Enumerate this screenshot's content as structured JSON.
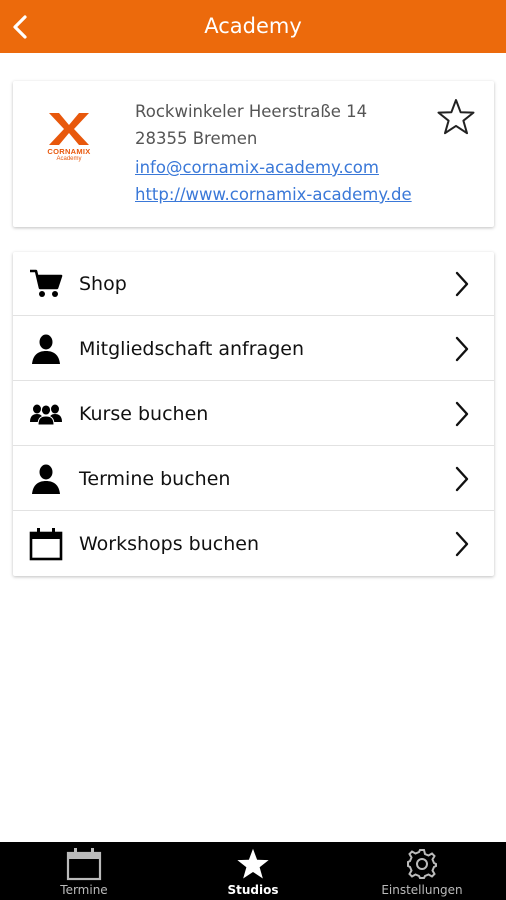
{
  "appbar": {
    "title": "Academy",
    "back_icon": "chevron-left-icon",
    "color": "#ec6a0c"
  },
  "studio": {
    "logo_text": "CORNAMIX",
    "logo_sub": "Academy",
    "address_line1": "Rockwinkeler Heerstraße 14",
    "address_line2": "28355 Bremen",
    "email": "info@cornamix-academy.com",
    "website": "http://www.cornamix-academy.de",
    "favorite_icon": "star-outline-icon"
  },
  "menu": [
    {
      "label": "Shop",
      "icon": "cart-icon"
    },
    {
      "label": "Mitgliedschaft anfragen",
      "icon": "person-icon"
    },
    {
      "label": "Kurse buchen",
      "icon": "group-icon"
    },
    {
      "label": "Termine buchen",
      "icon": "person-icon"
    },
    {
      "label": "Workshops buchen",
      "icon": "calendar-icon"
    }
  ],
  "tabbar": {
    "tabs": [
      {
        "label": "Termine",
        "icon": "calendar-icon",
        "active": false
      },
      {
        "label": "Studios",
        "icon": "star-icon",
        "active": true
      },
      {
        "label": "Einstellungen",
        "icon": "gear-icon",
        "active": false
      }
    ]
  }
}
